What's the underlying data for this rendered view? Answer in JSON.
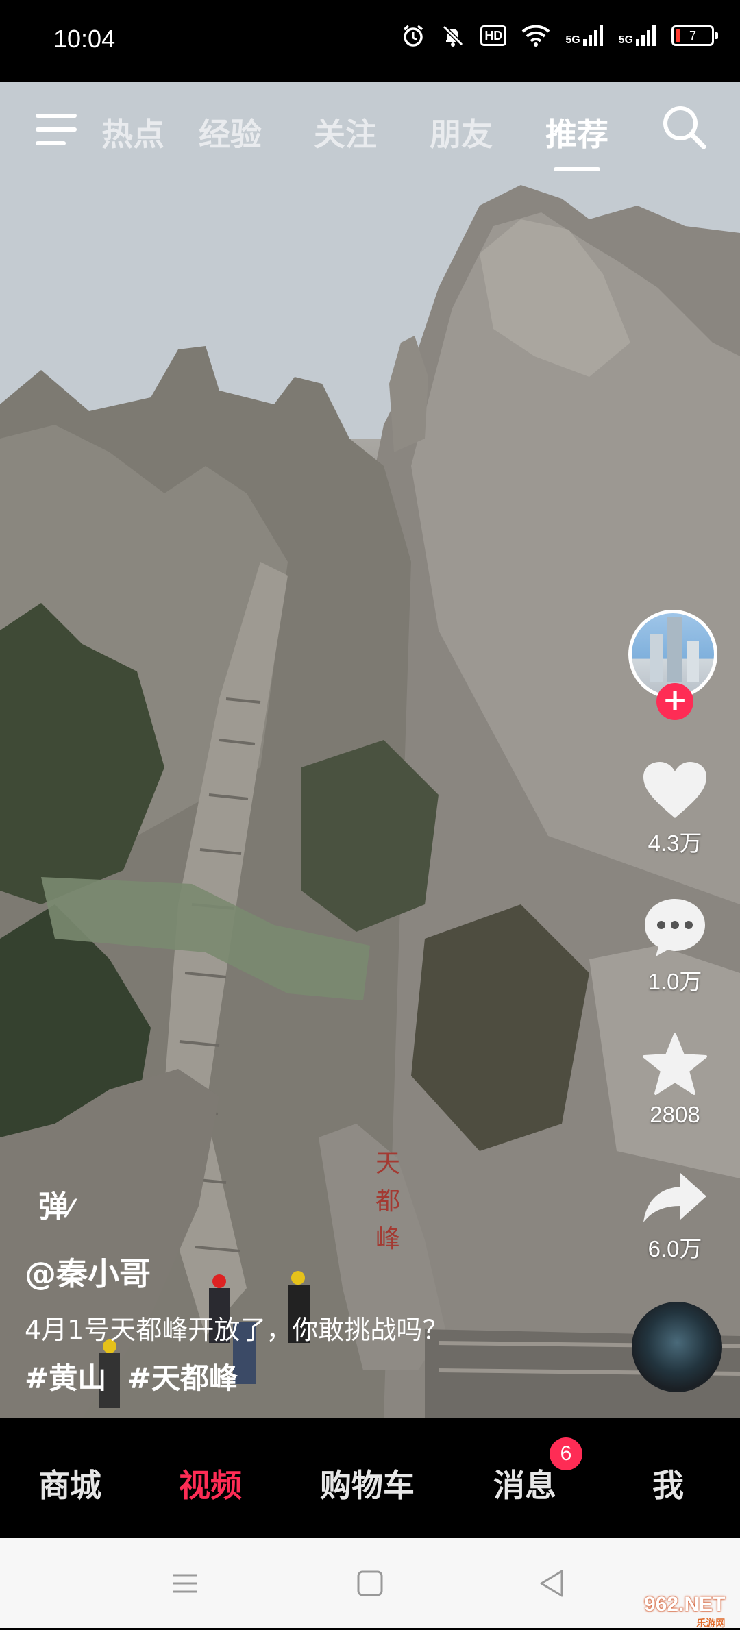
{
  "status_bar": {
    "time": "10:04",
    "battery_level": "7",
    "network_1": "5G",
    "network_2": "5G",
    "hd_label": "HD",
    "icons": [
      "alarm-icon",
      "mute-icon",
      "hd-icon",
      "wifi-icon",
      "signal-icon",
      "signal-icon",
      "battery-icon"
    ]
  },
  "top_nav": {
    "tabs": [
      {
        "label": "热点",
        "active": false
      },
      {
        "label": "经验",
        "active": false
      },
      {
        "label": "关注",
        "active": false
      },
      {
        "label": "朋友",
        "active": false
      },
      {
        "label": "推荐",
        "active": true
      }
    ]
  },
  "actions": {
    "like_count": "4.3万",
    "comment_count": "1.0万",
    "favorite_count": "2808",
    "share_count": "6.0万",
    "follow_symbol": "+"
  },
  "video": {
    "danmu_label": "弹",
    "author": "@秦小哥",
    "description": "4月1号天都峰开放了，你敢挑战吗？",
    "tags": [
      "#黄山",
      "#天都峰"
    ],
    "rock_inscription": "天都峰"
  },
  "bottom_nav": {
    "items": [
      {
        "label": "商城",
        "active": false
      },
      {
        "label": "视频",
        "active": true
      },
      {
        "label": "购物车",
        "active": false
      },
      {
        "label": "消息",
        "active": false,
        "badge": "6"
      },
      {
        "label": "我",
        "active": false
      }
    ]
  },
  "watermark": {
    "text": "962.NET",
    "sub": "乐游网"
  },
  "colors": {
    "accent": "#fe2c55",
    "background": "#000000",
    "system_nav_bg": "#f7f7f7"
  }
}
